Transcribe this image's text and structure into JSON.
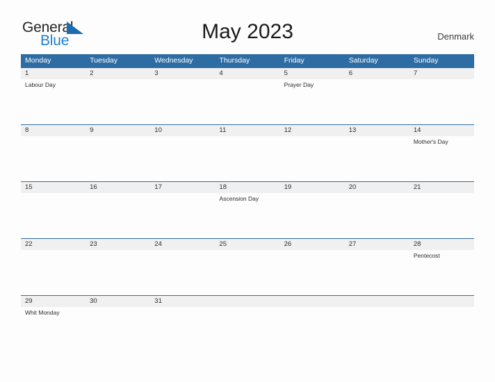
{
  "header": {
    "logo": {
      "word_one": "General",
      "word_two": "Blue",
      "flag_icon": "blue-triangle-flag"
    },
    "title": "May 2023",
    "country": "Denmark"
  },
  "colors": {
    "header_blue": "#2e6da4",
    "date_band_gray": "#f0f0f0",
    "logo_blue": "#1f7fd0",
    "text_dark": "#2b2b2b",
    "page_background": "#fdfdfd"
  },
  "calendar": {
    "weekdays": [
      "Monday",
      "Tuesday",
      "Wednesday",
      "Thursday",
      "Friday",
      "Saturday",
      "Sunday"
    ],
    "weeks": [
      {
        "days": [
          {
            "date": "1",
            "event": "Labour Day"
          },
          {
            "date": "2",
            "event": ""
          },
          {
            "date": "3",
            "event": ""
          },
          {
            "date": "4",
            "event": ""
          },
          {
            "date": "5",
            "event": "Prayer Day"
          },
          {
            "date": "6",
            "event": ""
          },
          {
            "date": "7",
            "event": ""
          }
        ]
      },
      {
        "days": [
          {
            "date": "8",
            "event": ""
          },
          {
            "date": "9",
            "event": ""
          },
          {
            "date": "10",
            "event": ""
          },
          {
            "date": "11",
            "event": ""
          },
          {
            "date": "12",
            "event": ""
          },
          {
            "date": "13",
            "event": ""
          },
          {
            "date": "14",
            "event": "Mother's Day"
          }
        ]
      },
      {
        "days": [
          {
            "date": "15",
            "event": ""
          },
          {
            "date": "16",
            "event": ""
          },
          {
            "date": "17",
            "event": ""
          },
          {
            "date": "18",
            "event": "Ascension Day"
          },
          {
            "date": "19",
            "event": ""
          },
          {
            "date": "20",
            "event": ""
          },
          {
            "date": "21",
            "event": ""
          }
        ]
      },
      {
        "days": [
          {
            "date": "22",
            "event": ""
          },
          {
            "date": "23",
            "event": ""
          },
          {
            "date": "24",
            "event": ""
          },
          {
            "date": "25",
            "event": ""
          },
          {
            "date": "26",
            "event": ""
          },
          {
            "date": "27",
            "event": ""
          },
          {
            "date": "28",
            "event": "Pentecost"
          }
        ]
      },
      {
        "days": [
          {
            "date": "29",
            "event": "Whit Monday"
          },
          {
            "date": "30",
            "event": ""
          },
          {
            "date": "31",
            "event": ""
          },
          {
            "date": "",
            "event": ""
          },
          {
            "date": "",
            "event": ""
          },
          {
            "date": "",
            "event": ""
          },
          {
            "date": "",
            "event": ""
          }
        ]
      }
    ]
  }
}
